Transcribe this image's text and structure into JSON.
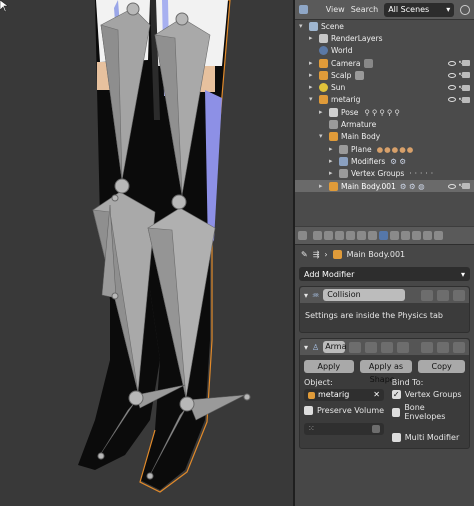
{
  "outliner": {
    "menu_view": "View",
    "menu_search": "Search",
    "scene_filter": "All Scenes",
    "rows": [
      {
        "label": "Scene",
        "icon": "scene-icon"
      },
      {
        "label": "RenderLayers",
        "icon": "renderlayers-icon"
      },
      {
        "label": "World",
        "icon": "world-icon"
      },
      {
        "label": "Camera",
        "icon": "camera-icon"
      },
      {
        "label": "Scalp",
        "icon": "mesh-icon"
      },
      {
        "label": "Sun",
        "icon": "lamp-icon"
      },
      {
        "label": "metarig",
        "icon": "armature-icon"
      },
      {
        "label": "Pose",
        "icon": "pose-icon"
      },
      {
        "label": "Armature",
        "icon": "armature-data-icon"
      },
      {
        "label": "Main Body",
        "icon": "mesh-icon"
      },
      {
        "label": "Plane",
        "icon": "mesh-data-icon"
      },
      {
        "label": "Modifiers",
        "icon": "wrench-icon"
      },
      {
        "label": "Vertex Groups",
        "icon": "vertex-groups-icon"
      },
      {
        "label": "Main Body.001",
        "icon": "mesh-icon"
      }
    ]
  },
  "properties": {
    "breadcrumb_object": "Main Body.001",
    "add_modifier": "Add Modifier",
    "collision": {
      "name": "Collision",
      "message": "Settings are inside the Physics tab"
    },
    "armature_mod": {
      "name": "Arma",
      "apply": "Apply",
      "apply_shape": "Apply as Shape...",
      "copy": "Copy",
      "object_label": "Object:",
      "object_value": "metarig",
      "bind_to_label": "Bind To:",
      "vertex_groups": "Vertex Groups",
      "preserve_volume": "Preserve Volume",
      "bone_envelopes": "Bone Envelopes",
      "multi_modifier": "Multi Modifier"
    }
  },
  "colors": {
    "accent": "#5680c2",
    "viewport_bg": "#393939",
    "panel_bg": "#474747"
  }
}
